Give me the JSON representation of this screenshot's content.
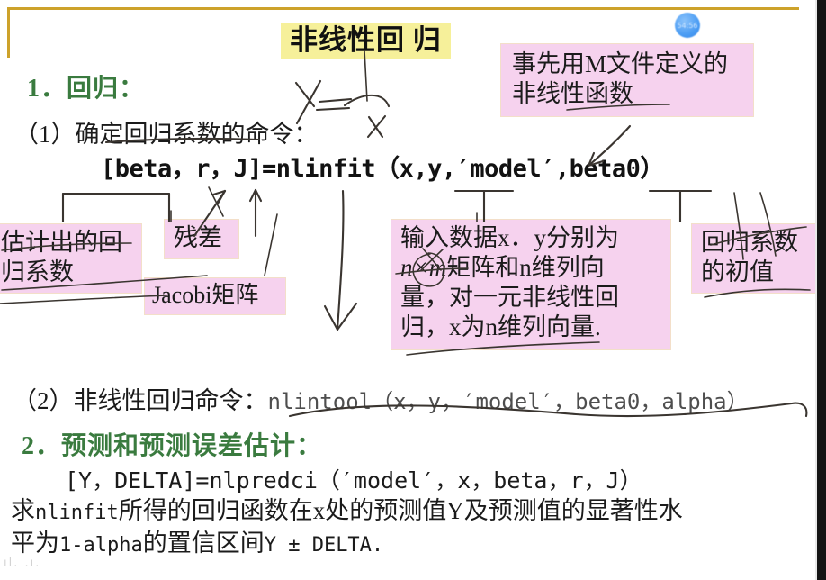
{
  "slide": {
    "title_highlight": "非线性回 归",
    "frame_color": "#cda22a",
    "highlight_yellow": "#f6f09a",
    "annotation_pink": "#f6d2ee",
    "heading_green": "#3a7b3f"
  },
  "headings": {
    "item1": "1．回归：",
    "item2": "2．预测和预测误差估计："
  },
  "commands": {
    "sub1_label": "（1）确定回归系数的命令：",
    "nlinfit": "[beta，r，J]=nlinfit（x,y,′model′,beta0）",
    "sub2_label": "（2）非线性回归命令：",
    "nlintool": "nlintool（x，y，′model′，beta0，alpha）",
    "nlpredci": "[Y，DELTA]=nlpredci（′model′，x，beta，r，J）"
  },
  "paragraph": {
    "line1_pre": "求",
    "line1_code": "nlinfit",
    "line1_post": "所得的回归函数在x处的预测值Y及预测值的显著性水",
    "line2_pre": "平为",
    "line2_code": "1-alpha",
    "line2_mid": "的置信区间",
    "line2_code2": "Y ± DELTA."
  },
  "annotations": {
    "mfile": "事先用M文件定义的非线性函数",
    "estimated_coef": "估计出的回归系数",
    "residual": "残差",
    "jacobi": "Jacobi矩阵",
    "input_data_l1": "输入数据x．y分别为",
    "input_data_l2_italic": "n×m",
    "input_data_l2_rest": "矩阵和n维列向",
    "input_data_l3": "量，对一元非线性回",
    "input_data_l4": "归，x为n维列向量.",
    "initial_value": "回归系数的初值"
  },
  "overlay": {
    "time_badge": "54:56",
    "handwriting_y": "Y",
    "handwriting_x": "x",
    "watermark": "ıl. .ı."
  }
}
